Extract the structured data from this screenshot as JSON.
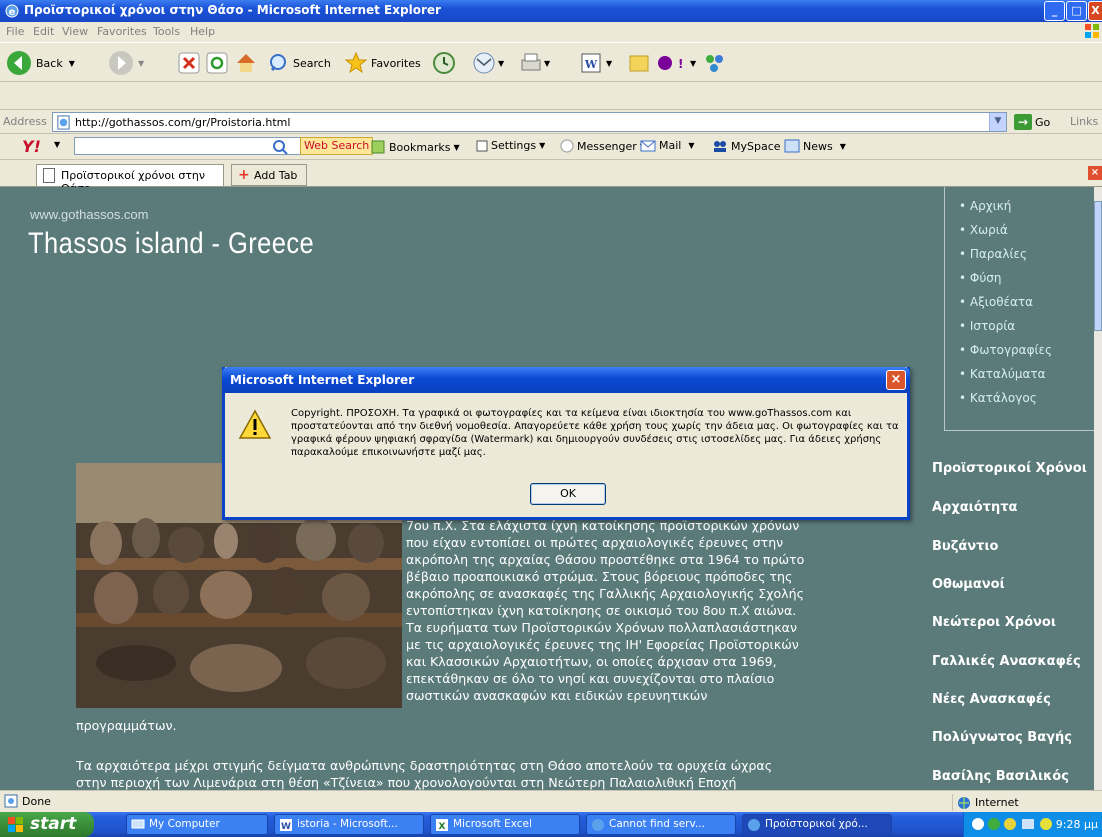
{
  "window": {
    "title": "Προϊστορικοί χρόνοι στην Θάσο - Microsoft Internet Explorer"
  },
  "menu": [
    "File",
    "Edit",
    "View",
    "Favorites",
    "Tools",
    "Help"
  ],
  "toolbar": {
    "back": "Back",
    "search": "Search",
    "favorites": "Favorites"
  },
  "address": {
    "label": "Address",
    "url": "http://gothassos.com/gr/Proistoria.html",
    "go": "Go",
    "links": "Links"
  },
  "yahoo": {
    "logo": "Y!",
    "web_search": "Web Search",
    "bookmarks": "Bookmarks",
    "settings": "Settings",
    "messenger": "Messenger",
    "mail": "Mail",
    "myspace": "MySpace",
    "news": "News"
  },
  "tabs": {
    "active": "Προϊστορικοί χρόνοι στην Θάσο",
    "add": "Add Tab"
  },
  "page": {
    "site_url": "www.gothassos.com",
    "site_title": "Thassos island - Greece",
    "nav": [
      "• Αρχική",
      "• Χωριά",
      "• Παραλίες",
      "• Φύση",
      "• Αξιοθέατα",
      "• Ιστορία",
      "• Φωτογραφίες",
      "• Καταλύματα",
      "• Κατάλογος"
    ],
    "sections": [
      "Προϊστορικοί Χρόνοι",
      "Αρχαιότητα",
      "Βυζάντιο",
      "Οθωμανοί",
      "Νεώτεροι Χρόνοι",
      "Γαλλικές Ανασκαφές",
      "Νέες Ανασκαφές",
      "Πολύγνωτος Βαγής",
      "Βασίλης Βασιλικός"
    ],
    "paragraph_lines": [
      "7ου π.Χ. Στα ελάχιστα ίχνη κατοίκησης προϊστορικών χρόνων",
      "που είχαν εντοπίσει οι πρώτες αρχαιολογικές έρευνες στην",
      "ακρόπολη της αρχαίας Θάσου προστέθηκε στα 1964 το πρώτο",
      "βέβαιο προαποικιακό στρώμα. Στους βόρειους πρόποδες της",
      "ακρόπολης σε ανασκαφές της Γαλλικής Αρχαιολογικής Σχολής",
      "εντοπίστηκαν ίχνη κατοίκησης σε οικισμό του 8ου π.Χ αιώνα.",
      "Τα ευρήματα των Προϊστορικών Χρόνων πολλαπλασιάστηκαν",
      "με τις αρχαιολογικές έρευνες της ΙΗ' Εφορείας Προϊστορικών",
      "και Κλασσικών Αρχαιοτήτων, οι οποίες άρχισαν στα 1969,",
      "επεκτάθηκαν σε όλο το νησί και συνεχίζονται στο πλαίσιο",
      "σωστικών ανασκαφών και ειδικών ερευνητικών"
    ],
    "para_end": "προγραμμάτων.",
    "para3_line1": "Τα αρχαιότερα μέχρι στιγμής δείγματα ανθρώπινης δραστηριότητας στη Θάσο αποτελούν τα ορυχεία ώχρας",
    "para3_line2": "στην περιοχή των Λιμενάρια στη θέση «Τζίνεια» που χρονολογούνται στη Νεώτερη Παλαιολιθική Εποχή"
  },
  "dialog": {
    "title": "Microsoft Internet Explorer",
    "message": "Copyright. ΠΡΟΣΟΧΗ. Τα γραφικά οι φωτογραφίες και τα κείμενα είναι ιδιοκτησία του  www.goThassos.com και προστατεύονται από την διεθνή νομοθεσία. Απαγορεύετε κάθε χρήση τους χωρίς την άδεια  μας. Οι φωτογραφίες και τα γραφικά φέρουν ψηφιακή σφραγίδα  (Watermark) και δημιουργούν συνδέσεις στις ιστοσελίδες μας. Για άδειες χρήσης παρακαλούμε επικοινωνήστε μαζί μας.",
    "ok": "OK"
  },
  "status": {
    "text": "Done",
    "zone": "Internet"
  },
  "taskbar": {
    "start": "start",
    "tasks": [
      "My Computer",
      "istoria - Microsoft...",
      "Microsoft Excel",
      "Cannot find serv...",
      "Προϊστορικοί χρό..."
    ],
    "clock": "9:28 μμ"
  }
}
